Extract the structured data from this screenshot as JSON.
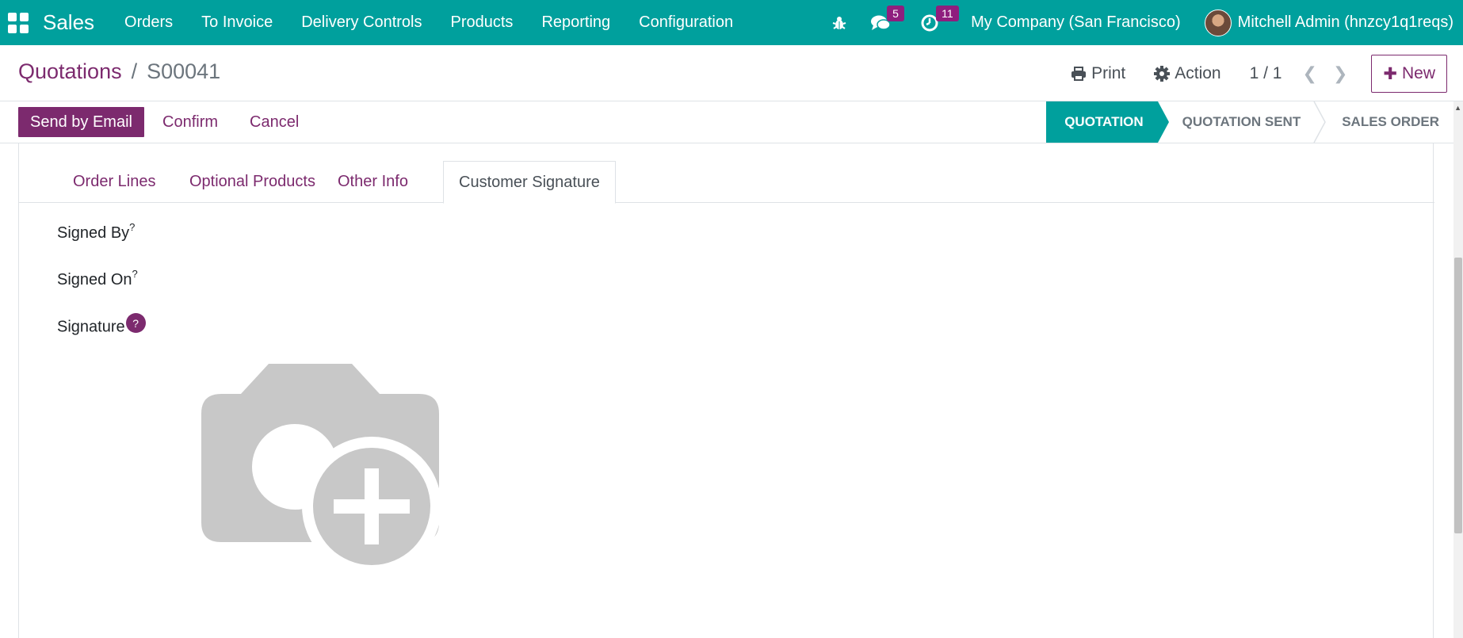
{
  "navbar": {
    "app_name": "Sales",
    "menu": [
      "Orders",
      "To Invoice",
      "Delivery Controls",
      "Products",
      "Reporting",
      "Configuration"
    ],
    "messages_count": "5",
    "activities_count": "11",
    "company": "My Company (San Francisco)",
    "user": "Mitchell Admin (hnzcy1q1reqs)"
  },
  "control_panel": {
    "breadcrumb_parent": "Quotations",
    "breadcrumb_separator": "/",
    "breadcrumb_current": "S00041",
    "print_label": "Print",
    "action_label": "Action",
    "pager": "1 / 1",
    "new_label": "New"
  },
  "statusbar": {
    "send_email_label": "Send by Email",
    "confirm_label": "Confirm",
    "cancel_label": "Cancel",
    "stages": [
      "QUOTATION",
      "QUOTATION SENT",
      "SALES ORDER"
    ],
    "active_stage": "QUOTATION"
  },
  "tabs": [
    "Order Lines",
    "Optional Products",
    "Other Info",
    "Customer Signature"
  ],
  "active_tab": "Customer Signature",
  "fields": {
    "signed_by": "Signed By",
    "signed_on": "Signed On",
    "signature": "Signature",
    "help_mark": "?"
  },
  "colors": {
    "navbar": "#00a09d",
    "primary": "#7c2a6e",
    "placeholder_gray": "#c8c8c8"
  },
  "icons": [
    "apps-grid-icon",
    "bug-icon",
    "chat-icon",
    "clock-icon",
    "print-icon",
    "gear-icon",
    "chevron-left-icon",
    "chevron-right-icon",
    "plus-icon",
    "camera-add-icon"
  ]
}
